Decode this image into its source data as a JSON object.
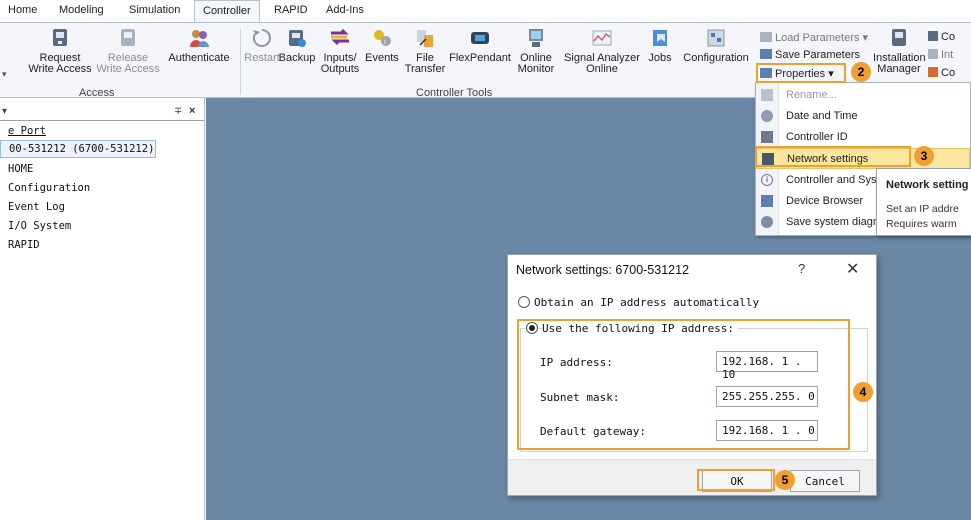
{
  "menu_tabs": [
    "Home",
    "Modeling",
    "Simulation",
    "Controller",
    "RAPID",
    "Add-Ins"
  ],
  "active_tab": "Controller",
  "ribbon": {
    "request_write_access": [
      "Request",
      "Write Access"
    ],
    "release_write_access": [
      "Release",
      "Write Access"
    ],
    "authenticate": "Authenticate",
    "restart": "Restart",
    "backup": "Backup",
    "inputs_outputs": [
      "Inputs/",
      "Outputs"
    ],
    "events": "Events",
    "file_transfer": [
      "File",
      "Transfer"
    ],
    "flexpendant": "FlexPendant",
    "online_monitor": [
      "Online",
      "Monitor"
    ],
    "signal_analyzer": [
      "Signal Analyzer",
      "Online"
    ],
    "jobs": "Jobs",
    "configuration": "Configuration",
    "load_parameters": "Load Parameters",
    "save_parameters": "Save Parameters",
    "properties": "Properties",
    "installation_manager": [
      "Installation",
      "Manager"
    ],
    "right_cut_1": "Co",
    "right_cut_2": "Int",
    "right_cut_3": "Co",
    "group_access": "Access",
    "group_controller_tools": "Controller Tools"
  },
  "tree": {
    "items": [
      "e Port",
      "00-531212 (6700-531212)",
      "HOME",
      "Configuration",
      "Event Log",
      "I/O System",
      "RAPID"
    ]
  },
  "dropdown": {
    "items": [
      {
        "label": "Rename...",
        "icon": "rename-icon",
        "disabled": true
      },
      {
        "label": "Date and Time",
        "icon": "clock-icon",
        "disabled": false
      },
      {
        "label": "Controller ID",
        "icon": "id-card-icon",
        "disabled": false
      },
      {
        "label": "Network settings",
        "icon": "network-icon",
        "disabled": false
      },
      {
        "label": "Controller and Sys",
        "icon": "info-icon",
        "disabled": false
      },
      {
        "label": "Device Browser",
        "icon": "device-browser-icon",
        "disabled": false
      },
      {
        "label": "Save system diagn",
        "icon": "diagnostics-icon",
        "disabled": false
      }
    ]
  },
  "tooltip": {
    "title": "Network setting",
    "line1": "Set an IP addre",
    "line2": "Requires warm"
  },
  "dialog": {
    "title": "Network settings: 6700-531212",
    "help": "?",
    "close": "✕",
    "option_auto": "Obtain an IP address automatically",
    "option_manual": "Use the following IP address:",
    "selected_option": "manual",
    "ip_label": "IP address:",
    "ip_value": "192.168. 1 . 10",
    "subnet_label": "Subnet mask:",
    "subnet_value": "255.255.255. 0",
    "gateway_label": "Default gateway:",
    "gateway_value": "192.168. 1 . 0",
    "ok": "OK",
    "cancel": "Cancel"
  },
  "badges": [
    "2",
    "3",
    "4",
    "5"
  ],
  "colors": {
    "annotation": "#f0a030",
    "workspace": "#6a87a6",
    "highlight": "#fde79e"
  }
}
